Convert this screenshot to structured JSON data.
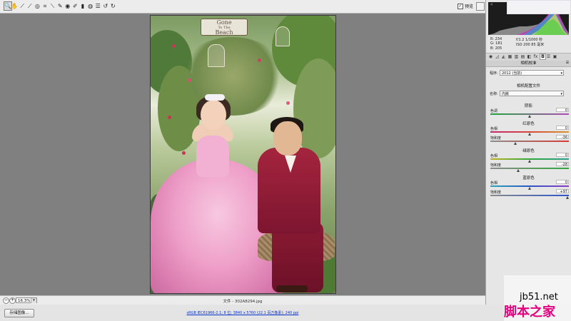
{
  "toolbar": {
    "tools": [
      {
        "name": "zoom-tool",
        "icon": "magnifier-icon",
        "glyph": "🔍",
        "active": true
      },
      {
        "name": "hand-tool",
        "icon": "hand-icon",
        "glyph": "✋"
      },
      {
        "name": "white-balance-tool",
        "icon": "eyedropper-icon",
        "glyph": "⟋"
      },
      {
        "name": "color-sampler-tool",
        "icon": "eyedropper-plus-icon",
        "glyph": "⟋"
      },
      {
        "name": "targeted-adjustment-tool",
        "icon": "target-adjust-icon",
        "glyph": "◎"
      },
      {
        "name": "crop-tool",
        "icon": "crop-icon",
        "glyph": "⌗"
      },
      {
        "name": "straighten-tool",
        "icon": "straighten-icon",
        "glyph": "⟍"
      },
      {
        "name": "spot-removal-tool",
        "icon": "spot-removal-icon",
        "glyph": "✎"
      },
      {
        "name": "red-eye-tool",
        "icon": "red-eye-icon",
        "glyph": "◉"
      },
      {
        "name": "adjustment-brush-tool",
        "icon": "brush-icon",
        "glyph": "✐"
      },
      {
        "name": "graduated-filter-tool",
        "icon": "graduated-filter-icon",
        "glyph": "▮"
      },
      {
        "name": "radial-filter-tool",
        "icon": "radial-filter-icon",
        "glyph": "◍"
      },
      {
        "name": "preferences-tool",
        "icon": "list-icon",
        "glyph": "☰"
      },
      {
        "name": "rotate-left-tool",
        "icon": "rotate-ccw-icon",
        "glyph": "↺"
      },
      {
        "name": "rotate-right-tool",
        "icon": "rotate-cw-icon",
        "glyph": "↻"
      }
    ],
    "preview_label": "预览",
    "preview_checked": true
  },
  "zoom": {
    "value": "16.3%"
  },
  "filename": "文件 - 302A8294.jpg",
  "footer": {
    "save_label": "存储图像...",
    "workflow_link": "sRGB IEC61966-2.1; 8 位; 3840 x 5760 (22.1 百万像素); 240 ppi"
  },
  "readout": {
    "r": "R:  234",
    "g": "G:  181",
    "b": "B:  205",
    "aperture_shutter": "f/1.2   1/1000 秒",
    "iso_focal": "ISO 200   85 毫米"
  },
  "panel": {
    "section_title": "相机校准",
    "process_label": "程序:",
    "process_value": "2012 (当前)",
    "camera_profile_title": "相机配置文件",
    "name_label": "名称:",
    "name_value": "内嵌",
    "groups": [
      {
        "title": "阴影",
        "rows": [
          {
            "label": "色调",
            "value": "0",
            "pos": 0.5,
            "track": "linear-gradient(90deg,#1ea53a,#b14bb6)"
          }
        ]
      },
      {
        "title": "红原色",
        "rows": [
          {
            "label": "色相",
            "value": "0",
            "pos": 0.5,
            "track": "linear-gradient(90deg,#c2276e,#d8473a,#d9962a)"
          },
          {
            "label": "饱和度",
            "value": "-36",
            "pos": 0.32,
            "track": "linear-gradient(90deg,#8c8c8c,#d33b35)"
          }
        ]
      },
      {
        "title": "绿原色",
        "rows": [
          {
            "label": "色相",
            "value": "0",
            "pos": 0.5,
            "track": "linear-gradient(90deg,#c0b323,#2fa73a,#2b9e8f)"
          },
          {
            "label": "饱和度",
            "value": "-28",
            "pos": 0.36,
            "track": "linear-gradient(90deg,#8c8c8c,#2fa73a)"
          }
        ]
      },
      {
        "title": "蓝原色",
        "rows": [
          {
            "label": "色相",
            "value": "0",
            "pos": 0.5,
            "track": "linear-gradient(90deg,#2aa6b8,#2b57c9,#8e3cc4)"
          },
          {
            "label": "饱和度",
            "value": "+97",
            "pos": 0.985,
            "track": "linear-gradient(90deg,#8c8c8c,#2b57c9)"
          }
        ]
      }
    ]
  },
  "panel_tabs": [
    {
      "icon": "aperture-icon",
      "glyph": "◉"
    },
    {
      "icon": "curve-icon",
      "glyph": "◿"
    },
    {
      "icon": "mountain-icon",
      "glyph": "◭"
    },
    {
      "icon": "hsl-grid-icon",
      "glyph": "▦"
    },
    {
      "icon": "split-tone-icon",
      "glyph": "▥"
    },
    {
      "icon": "detail-icon",
      "glyph": "▤"
    },
    {
      "icon": "lens-icon",
      "glyph": "◧"
    },
    {
      "icon": "fx-icon",
      "glyph": "fx"
    },
    {
      "icon": "camera-calibration-icon",
      "glyph": "◘",
      "active": true
    },
    {
      "icon": "presets-icon",
      "glyph": "☰"
    },
    {
      "icon": "snapshots-icon",
      "glyph": "▣"
    }
  ],
  "watermark": {
    "site": "jb51.net",
    "name": "脚本之家"
  },
  "colors": {
    "accent_link": "#0b34c8",
    "watermark": "#e6007e"
  }
}
